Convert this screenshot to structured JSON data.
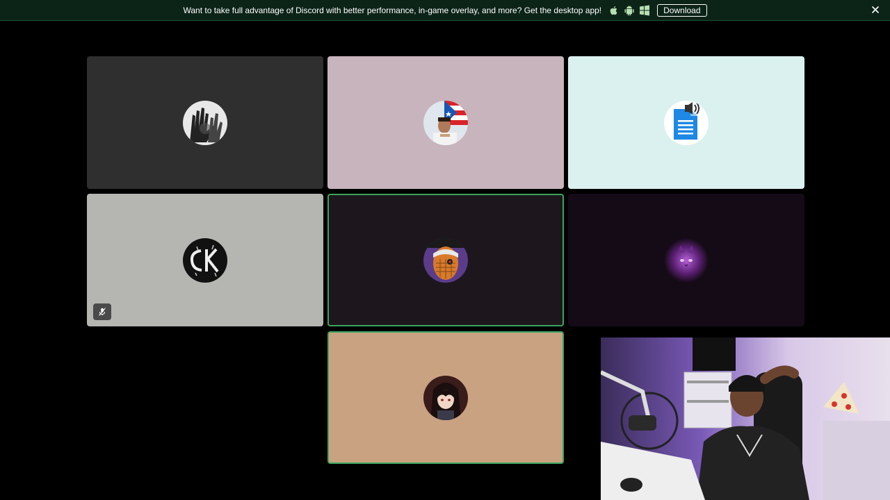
{
  "banner": {
    "message": "Want to take full advantage of Discord with better performance, in-game overlay, and more? Get the desktop app!",
    "download_label": "Download",
    "icons": [
      "apple-icon",
      "android-icon",
      "windows-icon"
    ],
    "close_icon": "close-icon"
  },
  "tiles": [
    {
      "name": "participant-tile-1",
      "bg": "#2f2f2f",
      "speaking": false,
      "muted": false,
      "avatar": "hands-avatar"
    },
    {
      "name": "participant-tile-2",
      "bg": "#c8b4bd",
      "speaking": false,
      "muted": false,
      "avatar": "flag-avatar"
    },
    {
      "name": "participant-tile-3",
      "bg": "#daf1ef",
      "speaking": false,
      "muted": false,
      "avatar": "document-speaker-avatar"
    },
    {
      "name": "participant-tile-4",
      "bg": "#b5b5b1",
      "speaking": false,
      "muted": true,
      "avatar": "ck-logo-avatar"
    },
    {
      "name": "participant-tile-5",
      "bg": "#1e161d",
      "speaking": true,
      "muted": false,
      "avatar": "masked-ninja-avatar"
    },
    {
      "name": "participant-tile-6",
      "bg": "#150b17",
      "speaking": false,
      "muted": false,
      "avatar": "purple-cat-avatar"
    },
    {
      "name": "participant-tile-7",
      "bg": "#c9a282",
      "speaking": true,
      "muted": false,
      "avatar": "anime-character-avatar"
    }
  ],
  "colors": {
    "banner_bg": "#0c2418",
    "speaking_border": "#3ba55d",
    "page_bg": "#000000"
  },
  "webcam": {
    "icon": "webcam-feed"
  }
}
